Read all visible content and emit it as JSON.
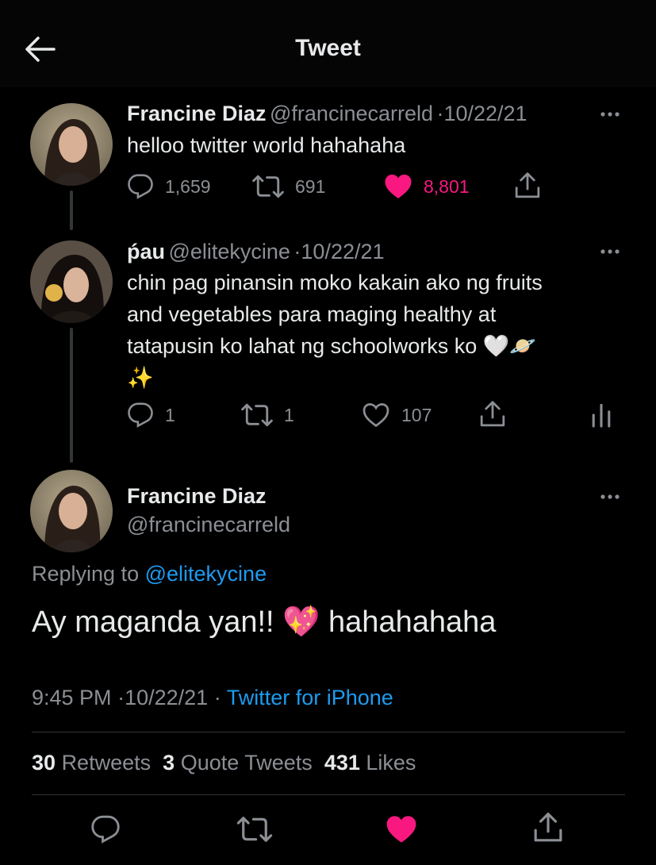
{
  "header": {
    "title": "Tweet"
  },
  "tweet1": {
    "name": "Francine Diaz",
    "handle": "@francinecarreld",
    "date_sep": "·",
    "date": "10/22/21",
    "text": "helloo twitter world hahahaha",
    "replies": "1,659",
    "retweets": "691",
    "likes": "8,801",
    "liked": true
  },
  "tweet2": {
    "name": "ṕau",
    "handle": "@elitekycine",
    "date_sep": "·",
    "date": "10/22/21",
    "text_line1": "chin pag pinansin moko kakain ako ng fruits",
    "text_line2": "and vegetables para maging healthy at",
    "text_line3": "tatapusin ko lahat ng schoolworks ko 🤍🪐",
    "text_line4": "✨",
    "replies": "1",
    "retweets": "1",
    "likes": "107"
  },
  "main": {
    "name": "Francine Diaz",
    "handle": "@francinecarreld",
    "replying_prefix": "Replying to",
    "replying_to": "@elitekycine",
    "text": "Ay maganda yan!! 💖  hahahahaha",
    "time": "9:45 PM",
    "sep1": "·",
    "date": "10/22/21",
    "sep2": "·",
    "source": "Twitter for iPhone",
    "stats": {
      "retweets_count": "30",
      "retweets_label": "Retweets",
      "quotes_count": "3",
      "quotes_label": "Quote Tweets",
      "likes_count": "431",
      "likes_label": "Likes"
    }
  },
  "colors": {
    "background": "#000000",
    "text_primary": "#e7e9ea",
    "text_secondary": "#8b8f94",
    "link_blue": "#1d9bf0",
    "like_pink": "#f91880"
  }
}
